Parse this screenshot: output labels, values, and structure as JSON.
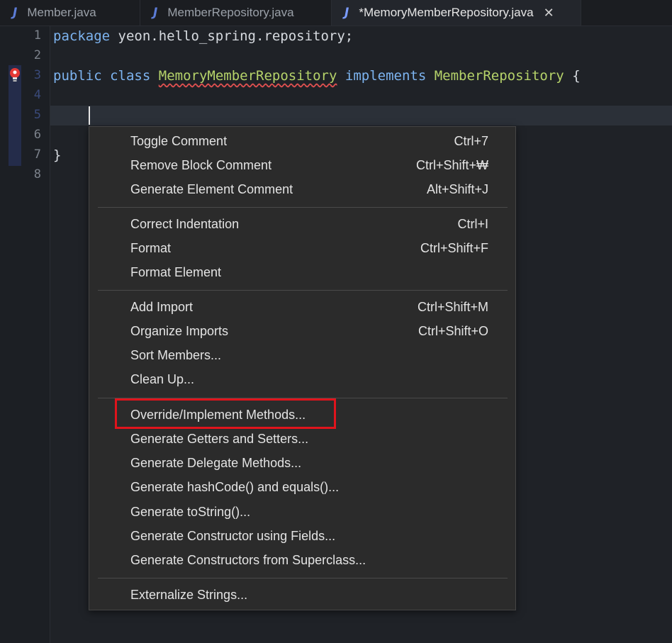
{
  "tabs": [
    {
      "icon": "java-file-icon",
      "label": "Member.java",
      "active": false
    },
    {
      "icon": "java-file-icon",
      "label": "MemberRepository.java",
      "active": false
    },
    {
      "icon": "java-file-icon",
      "label": "*MemoryMemberRepository.java",
      "active": true
    }
  ],
  "tab_icon_glyph": "J",
  "close_glyph": "✕",
  "editor": {
    "line_numbers": [
      "1",
      "2",
      "3",
      "4",
      "5",
      "6",
      "7",
      "8"
    ],
    "line1": {
      "kw": "package",
      "rest": " yeon.hello_spring.repository;"
    },
    "line3": {
      "kw1": "public",
      "kw2": "class",
      "cls": "MemoryMemberRepository",
      "kw3": "implements",
      "iface": "MemberRepository",
      "brace": "{"
    },
    "line7": {
      "brace": "}"
    }
  },
  "menu": {
    "groups": [
      [
        {
          "label": "Toggle Comment",
          "shortcut": "Ctrl+7"
        },
        {
          "label": "Remove Block Comment",
          "shortcut": "Ctrl+Shift+₩"
        },
        {
          "label": "Generate Element Comment",
          "shortcut": "Alt+Shift+J"
        }
      ],
      [
        {
          "label": "Correct Indentation",
          "shortcut": "Ctrl+I"
        },
        {
          "label": "Format",
          "shortcut": "Ctrl+Shift+F"
        },
        {
          "label": "Format Element",
          "shortcut": ""
        }
      ],
      [
        {
          "label": "Add Import",
          "shortcut": "Ctrl+Shift+M"
        },
        {
          "label": "Organize Imports",
          "shortcut": "Ctrl+Shift+O"
        },
        {
          "label": "Sort Members...",
          "shortcut": ""
        },
        {
          "label": "Clean Up...",
          "shortcut": ""
        }
      ],
      [
        {
          "label": "Override/Implement Methods...",
          "shortcut": ""
        },
        {
          "label": "Generate Getters and Setters...",
          "shortcut": ""
        },
        {
          "label": "Generate Delegate Methods...",
          "shortcut": ""
        },
        {
          "label": "Generate hashCode() and equals()...",
          "shortcut": ""
        },
        {
          "label": "Generate toString()...",
          "shortcut": ""
        },
        {
          "label": "Generate Constructor using Fields...",
          "shortcut": ""
        },
        {
          "label": "Generate Constructors from Superclass...",
          "shortcut": ""
        }
      ],
      [
        {
          "label": "Externalize Strings...",
          "shortcut": ""
        }
      ]
    ]
  },
  "colors": {
    "highlight": "#e0141c",
    "keyword": "#7db4f0",
    "class": "#b6d36a",
    "bulb": "#e53935"
  }
}
